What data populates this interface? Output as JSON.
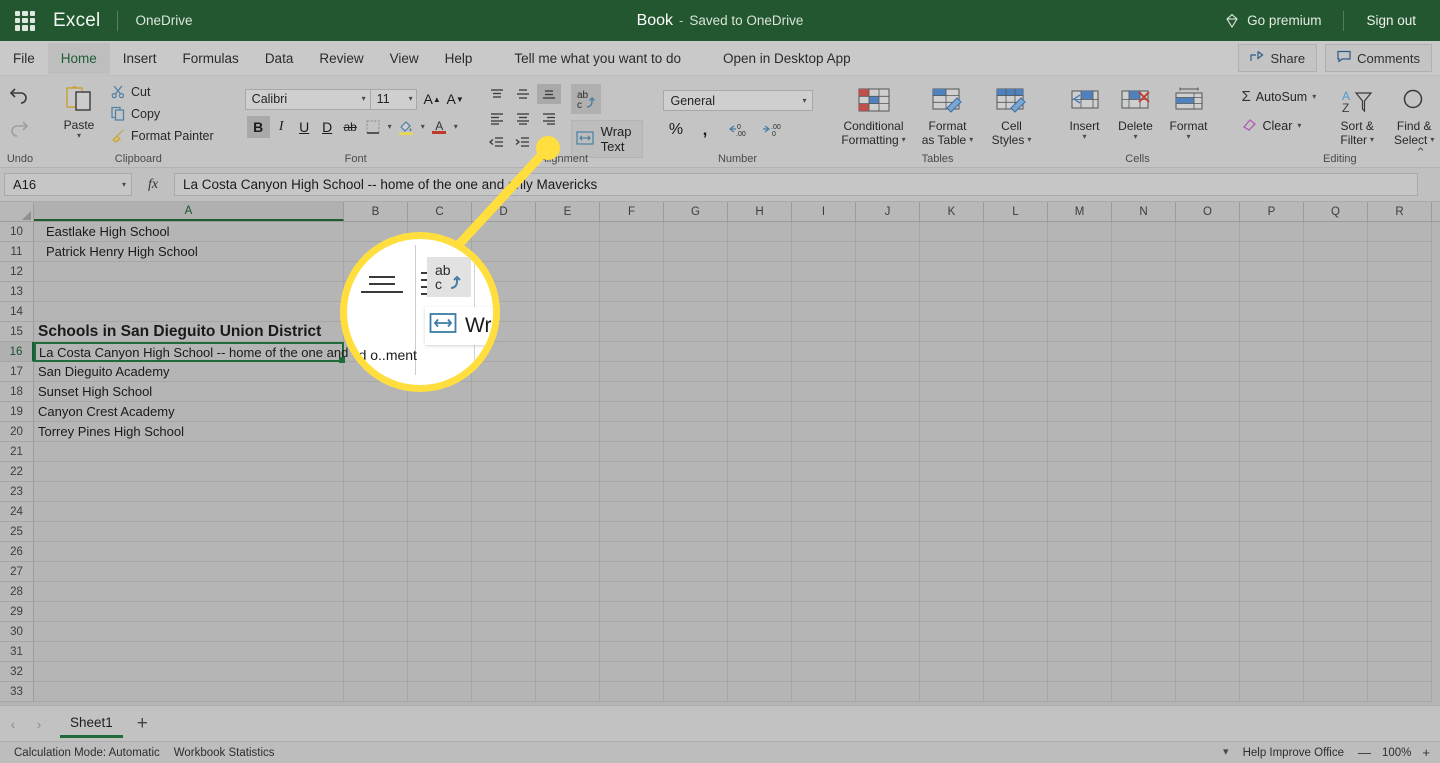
{
  "titlebar": {
    "app_name": "Excel",
    "storage": "OneDrive",
    "doc_name": "Book",
    "dash": "-",
    "save_state": "Saved to OneDrive",
    "go_premium": "Go premium",
    "sign_out": "Sign out",
    "waffle_icon": "app-launcher-icon",
    "premium_icon": "diamond-icon",
    "bg_color": "#23572f"
  },
  "menubar": {
    "items": [
      {
        "label": "File",
        "active": false
      },
      {
        "label": "Home",
        "active": true
      },
      {
        "label": "Insert",
        "active": false
      },
      {
        "label": "Formulas",
        "active": false
      },
      {
        "label": "Data",
        "active": false
      },
      {
        "label": "Review",
        "active": false
      },
      {
        "label": "View",
        "active": false
      },
      {
        "label": "Help",
        "active": false
      }
    ],
    "tell_me": "Tell me what you want to do",
    "open_desktop": "Open in Desktop App",
    "share": "Share",
    "comments": "Comments",
    "share_icon": "share-icon",
    "comments_icon": "comment-bubble-icon"
  },
  "ribbon": {
    "undo": {
      "label": "Undo",
      "undo_icon": "undo-arrow-icon",
      "redo_icon": "redo-arrow-icon"
    },
    "clipboard": {
      "label": "Clipboard",
      "paste": "Paste",
      "cut": "Cut",
      "copy": "Copy",
      "format_painter": "Format Painter",
      "paste_icon": "clipboard-icon",
      "cut_icon": "scissors-icon",
      "copy_icon": "copy-pages-icon",
      "painter_icon": "paintbrush-icon"
    },
    "font": {
      "label": "Font",
      "font_name": "Calibri",
      "font_size": "11",
      "grow_font": "A",
      "shrink_font": "A",
      "bold": "B",
      "italic": "I",
      "underline": "U",
      "double_underline": "D",
      "strikethrough": "ab",
      "borders_icon": "borders-icon",
      "fill_icon": "fill-color-icon",
      "font_color": "A"
    },
    "alignment": {
      "label": "Alignment",
      "align_top_icon": "align-top-icon",
      "align_middle_icon": "align-middle-icon",
      "align_bottom_icon": "align-bottom-icon",
      "align_left_icon": "align-left-icon",
      "align_center_icon": "align-center-icon",
      "align_right_icon": "align-right-icon",
      "decrease_indent_icon": "decrease-indent-icon",
      "increase_indent_icon": "increase-indent-icon",
      "orientation_icon": "text-orientation-abc-icon",
      "wrap_text": "Wrap Text",
      "wrap_icon": "wrap-text-icon"
    },
    "number": {
      "label": "Number",
      "format": "General",
      "percent": "%",
      "comma": ",",
      "increase_decimal_icon": "increase-decimal-icon",
      "decrease_decimal_icon": "decrease-decimal-icon"
    },
    "tables": {
      "label": "Tables",
      "conditional_formatting": "Conditional\nFormatting",
      "conditional_formatting_l1": "Conditional",
      "conditional_formatting_l2": "Formatting",
      "format_as_table_l1": "Format",
      "format_as_table_l2": "as Table",
      "cell_styles_l1": "Cell",
      "cell_styles_l2": "Styles",
      "cf_icon": "conditional-formatting-icon",
      "fat_icon": "format-as-table-icon",
      "cs_icon": "cell-styles-icon"
    },
    "cells": {
      "label": "Cells",
      "insert": "Insert",
      "delete": "Delete",
      "format": "Format",
      "insert_icon": "insert-cells-icon",
      "delete_icon": "delete-cells-icon",
      "format_icon": "format-cells-icon"
    },
    "editing": {
      "label": "Editing",
      "autosum": "AutoSum",
      "clear": "Clear",
      "sort_filter_l1": "Sort &",
      "sort_filter_l2": "Filter",
      "find_select_l1": "Find &",
      "find_select_l2": "Select",
      "autosum_icon": "sigma-icon",
      "clear_icon": "eraser-icon",
      "sort_icon": "sort-filter-icon",
      "find_icon": "magnifier-icon"
    },
    "collapse_icon": "chevron-up-icon"
  },
  "formula_bar": {
    "name_box": "A16",
    "fx_label": "fx",
    "formula_value": "La Costa Canyon High School -- home of the one and only Mavericks",
    "name_box_caret_icon": "chevron-down-icon"
  },
  "grid": {
    "columns": [
      "A",
      "B",
      "C",
      "D",
      "E",
      "F",
      "G",
      "H",
      "I",
      "J",
      "K",
      "L",
      "M",
      "N",
      "O",
      "P",
      "Q",
      "R"
    ],
    "selected_column": "A",
    "selected_row": 16,
    "rows": [
      {
        "n": 10,
        "a": "Eastlake High School",
        "style": "indent"
      },
      {
        "n": 11,
        "a": "Patrick Henry High School",
        "style": "indent"
      },
      {
        "n": 12,
        "a": ""
      },
      {
        "n": 13,
        "a": ""
      },
      {
        "n": 14,
        "a": ""
      },
      {
        "n": 15,
        "a": "Schools in San Dieguito Union District",
        "style": "big"
      },
      {
        "n": 16,
        "a": "La Costa Canyon High School -- home of the one and only Mavericks",
        "style": "selected"
      },
      {
        "n": 17,
        "a": "San Dieguito Academy"
      },
      {
        "n": 18,
        "a": "Sunset High School"
      },
      {
        "n": 19,
        "a": "Canyon Crest Academy"
      },
      {
        "n": 20,
        "a": "Torrey Pines High School"
      },
      {
        "n": 21,
        "a": ""
      },
      {
        "n": 22,
        "a": ""
      },
      {
        "n": 23,
        "a": ""
      },
      {
        "n": 24,
        "a": ""
      },
      {
        "n": 25,
        "a": ""
      },
      {
        "n": 26,
        "a": ""
      },
      {
        "n": 27,
        "a": ""
      },
      {
        "n": 28,
        "a": ""
      },
      {
        "n": 29,
        "a": ""
      },
      {
        "n": 30,
        "a": ""
      },
      {
        "n": 31,
        "a": ""
      },
      {
        "n": 32,
        "a": ""
      },
      {
        "n": 33,
        "a": ""
      }
    ]
  },
  "sheetbar": {
    "prev_icon": "chevron-left-icon",
    "next_icon": "chevron-right-icon",
    "sheet_name": "Sheet1",
    "add_sheet": "+",
    "add_sheet_icon": "plus-icon"
  },
  "statusbar": {
    "calc_mode": "Calculation Mode: Automatic",
    "workbook_stats": "Workbook Statistics",
    "more_icon": "chevron-down-icon",
    "help_improve": "Help Improve Office",
    "zoom_out": "—",
    "zoom_level": "100%",
    "zoom_in": "+"
  },
  "callout": {
    "magnified_wrap_label": "Wrap",
    "magnified_cell_text": "and o..ment",
    "abc_icon": "text-orientation-abc-icon",
    "wrap_icon": "wrap-text-icon",
    "highlight_color": "#ffde3d"
  }
}
